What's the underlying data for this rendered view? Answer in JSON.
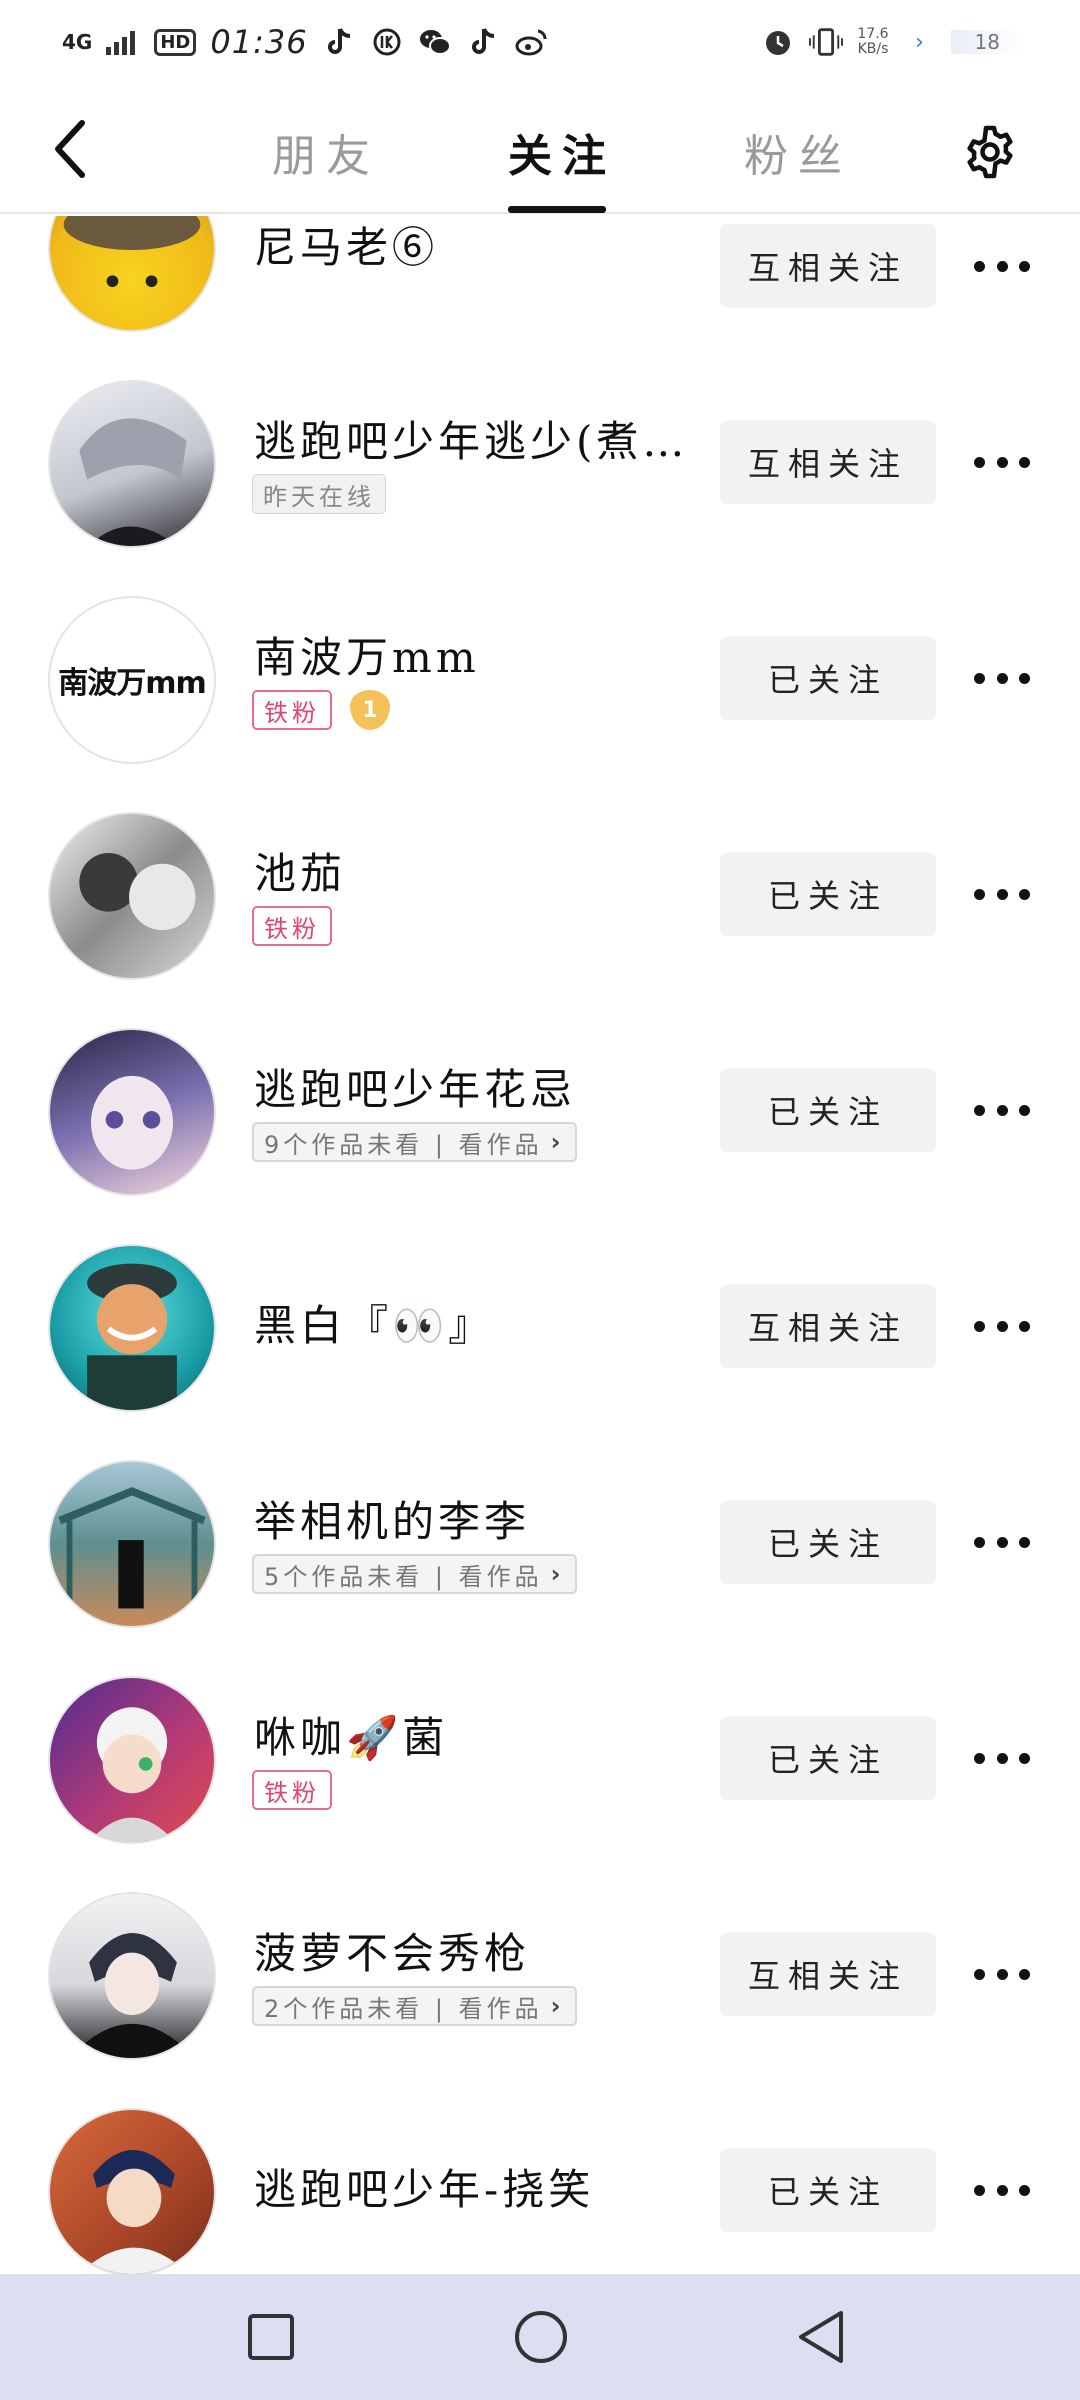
{
  "status_bar": {
    "network": "4G",
    "hd": "HD",
    "time": "01:36",
    "speed_value": "17.6",
    "speed_unit": "KB/s",
    "battery": "18"
  },
  "nav": {
    "tabs": [
      {
        "label": "朋友",
        "active": false
      },
      {
        "label": "关注",
        "active": true
      },
      {
        "label": "粉丝",
        "active": false
      }
    ]
  },
  "users": [
    {
      "name": "尼马老⑥",
      "button": "互相关注",
      "badge": null,
      "avatar_color": "#f1c21a"
    },
    {
      "name": "逃跑吧少年逃少(煮…",
      "button": "互相关注",
      "badge": {
        "type": "online",
        "text": "昨天在线"
      },
      "avatar_color": "#b9bcc4"
    },
    {
      "name": "南波万mm",
      "button": "已关注",
      "badge": {
        "type": "iron",
        "text": "铁粉"
      },
      "level": "1",
      "avatar_text": "南波万mm",
      "avatar_color": "#ffffff"
    },
    {
      "name": "池茄",
      "button": "已关注",
      "badge": {
        "type": "iron",
        "text": "铁粉"
      },
      "avatar_color": "#9c9c9c"
    },
    {
      "name": "逃跑吧少年花忌",
      "button": "已关注",
      "badge": {
        "type": "works",
        "text": "9个作品未看 | 看作品"
      },
      "avatar_color": "#5a4f86"
    },
    {
      "name": "黑白『👀』",
      "button": "互相关注",
      "badge": null,
      "avatar_color": "#1fa8ad"
    },
    {
      "name": "举相机的李李",
      "button": "已关注",
      "badge": {
        "type": "works",
        "text": "5个作品未看 | 看作品"
      },
      "avatar_color": "#4a7d7f"
    },
    {
      "name": "咻咖🚀菌",
      "button": "已关注",
      "badge": {
        "type": "iron",
        "text": "铁粉"
      },
      "avatar_color": "#8d3f86"
    },
    {
      "name": "菠萝不会秀枪",
      "button": "互相关注",
      "badge": {
        "type": "works",
        "text": "2个作品未看 | 看作品"
      },
      "avatar_color": "#2b2b33"
    },
    {
      "name": "逃跑吧少年-挠笑",
      "button": "已关注",
      "badge": null,
      "avatar_color": "#c9603e"
    }
  ]
}
